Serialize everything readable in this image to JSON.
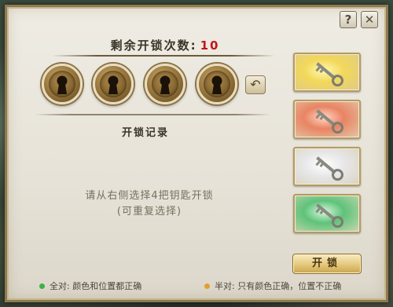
{
  "header": {
    "remaining_label": "剩余开锁次数:",
    "remaining_count": "10",
    "help_label": "?",
    "close_label": "✕"
  },
  "locks": [
    {
      "icon": "keyhole-icon"
    },
    {
      "icon": "keyhole-icon"
    },
    {
      "icon": "keyhole-icon"
    },
    {
      "icon": "keyhole-icon"
    }
  ],
  "undo": {
    "label": "↶",
    "icon": "undo-arrow-icon"
  },
  "record": {
    "title": "开锁记录",
    "instruction_line1": "请从右侧选择4把钥匙开锁",
    "instruction_line2": "(可重复选择)"
  },
  "keys": [
    {
      "color_name": "yellow",
      "glow": "#f2d85a"
    },
    {
      "color_name": "red",
      "glow": "#e98463"
    },
    {
      "color_name": "white",
      "glow": "#e8e8ea"
    },
    {
      "color_name": "green",
      "glow": "#5fc27a"
    }
  ],
  "unlock_button": {
    "label": "开锁"
  },
  "legend": {
    "full_match": {
      "text": "全对: 颜色和位置都正确",
      "color": "#3fae4a"
    },
    "half_match": {
      "text": "半对: 只有颜色正确，位置不正确",
      "color": "#e0a030"
    }
  }
}
